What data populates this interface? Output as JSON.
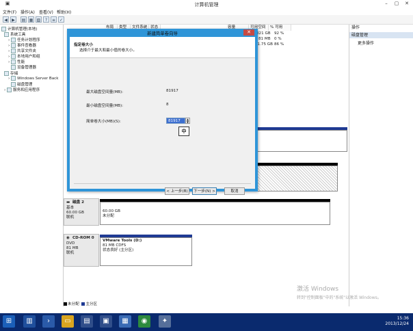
{
  "window": {
    "title": "计算机管理"
  },
  "menu": [
    "文件(F)",
    "操作(A)",
    "查看(V)",
    "帮助(H)"
  ],
  "tree": {
    "root": "计算机管理(本地)",
    "system_tools": "系统工具",
    "items": [
      "任务计划程序",
      "事件查看器",
      "共享文件夹",
      "本地用户和组",
      "性能",
      "设备管理器"
    ],
    "storage": "存储",
    "storage_items": [
      "Windows Server Back",
      "磁盘管理"
    ],
    "services": "服务和应用程序"
  },
  "volume_table": {
    "headers": [
      "布局",
      "类型",
      "文件系统",
      "状态",
      "容量",
      "可用空间",
      "% 可用"
    ],
    "rows": [
      {
        "free": "81 MB",
        "pct": "0 %"
      },
      {
        "free": "51.75 GB",
        "pct": "86 %"
      }
    ],
    "first_row": {
      "free": "321 GB",
      "pct": "92 %"
    }
  },
  "actions": {
    "header": "操作",
    "section": "磁盘管理",
    "more": "更多操作"
  },
  "disks": [
    {
      "name": "磁盘 2",
      "type": "基本",
      "size": "60.00 GB",
      "status": "联机",
      "part_size": "60.00 GB",
      "part_status": "未分配"
    },
    {
      "name": "CD-ROM 0",
      "type": "DVD",
      "size": "81 MB",
      "status": "联机",
      "part_name": "VMware Tools  (D:)",
      "part_fs": "81 MB CDFS",
      "part_status": "状态良好 (主分区)"
    }
  ],
  "legend": {
    "unallocated": "未分配",
    "primary": "主分区"
  },
  "wizard": {
    "title": "新建简单卷向导",
    "heading": "指定卷大小",
    "subheading": "选择介于最大和最小值的卷大小。",
    "max_label": "最大磁盘空间量(MB):",
    "max_value": "81917",
    "min_label": "最小磁盘空间量(MB):",
    "min_value": "8",
    "size_label": "简单卷大小(MB)(S):",
    "size_value": "81917",
    "ime": "中",
    "back": "< 上一步(B)",
    "next": "下一步(N) >",
    "cancel": "取消"
  },
  "watermark": {
    "line1": "激活 Windows",
    "line2": "转到\"控制面板\"中的\"系统\"以激活 Windows。"
  },
  "clock": {
    "time": "15:36",
    "date": "2013/12/24"
  }
}
